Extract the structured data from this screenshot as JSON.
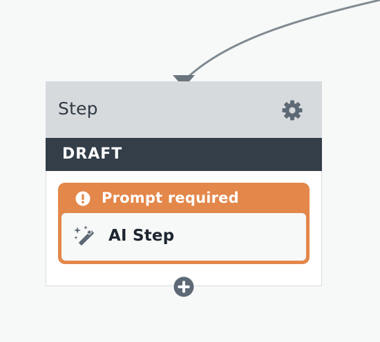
{
  "node": {
    "title": "Step",
    "status": "DRAFT",
    "warning": "Prompt required",
    "step_label": "AI Step"
  },
  "icons": {
    "settings": "gear-icon",
    "warning": "exclamation-circle-icon",
    "step": "magic-wand-icon",
    "add": "plus-circle-icon"
  },
  "colors": {
    "canvas_bg": "#f7f8f8",
    "header_bg": "#d7dadd",
    "status_bg": "#333e48",
    "warning_bg": "#e3874a",
    "icon_gray": "#5d6a75",
    "connector": "#808a91"
  }
}
